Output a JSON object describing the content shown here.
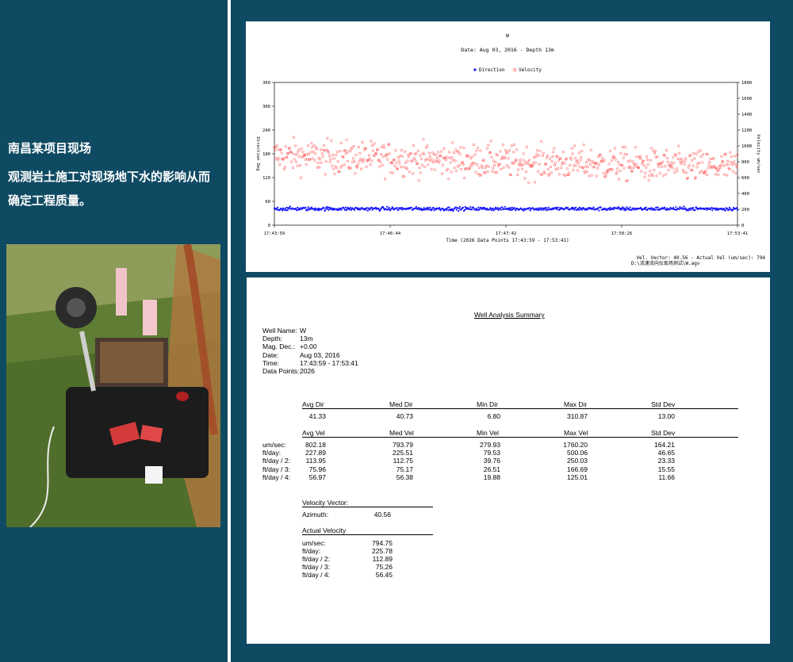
{
  "left_panel": {
    "title": "南昌某项目现场",
    "description": "观测岩土施工对现场地下水的影响从而确定工程质量。"
  },
  "chart_data": {
    "type": "scatter",
    "title": "W",
    "subtitle": "Date: Aug 03, 2016 - Depth 13m",
    "legend": [
      {
        "name": "Direction",
        "color": "#1a1aff",
        "marker": "dot"
      },
      {
        "name": "Velocity",
        "color": "#ff2a2a",
        "marker": "circle"
      }
    ],
    "legend_position": "top-center",
    "xlabel": "Time (2026 Data Points 17:43:59 - 17:53:41)",
    "ylabel_left": "Direction Deg",
    "ylabel_right": "Velocity um/sec",
    "x_ticks": [
      "17:43:59",
      "17:46:44",
      "17:47:42",
      "17:50:26",
      "17:53:41"
    ],
    "y_left_ticks": [
      "0",
      "60",
      "120",
      "180",
      "240",
      "300",
      "360"
    ],
    "y_right_ticks": [
      "0",
      "200",
      "400",
      "600",
      "800",
      "1000",
      "1200",
      "1400",
      "1600",
      "1800"
    ],
    "ylim_left": [
      0,
      360
    ],
    "ylim_right": [
      0,
      1800
    ],
    "n_points": 2026,
    "direction_summary": {
      "avg": 41.33,
      "min": 6.8,
      "max": 310.87,
      "std": 13.0
    },
    "velocity_summary": {
      "avg": 802.18,
      "min": 279.93,
      "max": 1760.2,
      "std": 164.21
    },
    "footer_line1": "Vel. Vector: 40.56 - Actual Vel (um/sec): 794",
    "footer_line2": "D:\\流速流向仪现场测试\\W.agv"
  },
  "summary": {
    "heading": "Well Analysis Summary",
    "info": [
      {
        "label": "Well Name:",
        "value": "W"
      },
      {
        "label": "Depth:",
        "value": "13m"
      },
      {
        "label": "Mag. Dec.:",
        "value": "+0.00"
      },
      {
        "label": "Date:",
        "value": "Aug 03, 2016"
      },
      {
        "label": "Time:",
        "value": "17:43:59 - 17:53:41"
      },
      {
        "label": "Data Points:",
        "value": "2026"
      }
    ],
    "dir_headers": [
      "Avg Dir",
      "Med Dir",
      "Min Dir",
      "Max Dir",
      "Std Dev"
    ],
    "dir_values": [
      "41.33",
      "40.73",
      "6.80",
      "310.87",
      "13.00"
    ],
    "vel_headers": [
      "Avg Vel",
      "Med Vel",
      "Min Vel",
      "Max Vel",
      "Std Dev"
    ],
    "vel_rows": [
      {
        "unit": "um/sec:",
        "values": [
          "802.18",
          "793.79",
          "279.93",
          "1760.20",
          "164.21"
        ]
      },
      {
        "unit": "ft/day:",
        "values": [
          "227.89",
          "225.51",
          "79.53",
          "500.06",
          "46.65"
        ]
      },
      {
        "unit": "ft/day / 2:",
        "values": [
          "113.95",
          "112.75",
          "39.76",
          "250.03",
          "23.33"
        ]
      },
      {
        "unit": "ft/day / 3:",
        "values": [
          "75.96",
          "75.17",
          "26.51",
          "166.69",
          "15.55"
        ]
      },
      {
        "unit": "ft/day / 4:",
        "values": [
          "56.97",
          "56.38",
          "19.88",
          "125.01",
          "11.66"
        ]
      }
    ],
    "vector_title": "Velocity Vector:",
    "azimuth_label": "Azimuth:",
    "azimuth_value": "40.56",
    "actual_title": "Actual Velocity",
    "actual_rows": [
      {
        "unit": "um/sec:",
        "value": "794.75"
      },
      {
        "unit": "ft/day:",
        "value": "225.78"
      },
      {
        "unit": "ft/day / 2:",
        "value": "112.89"
      },
      {
        "unit": "ft/day / 3:",
        "value": "75.26"
      },
      {
        "unit": "ft/day / 4:",
        "value": "56.45"
      }
    ]
  }
}
